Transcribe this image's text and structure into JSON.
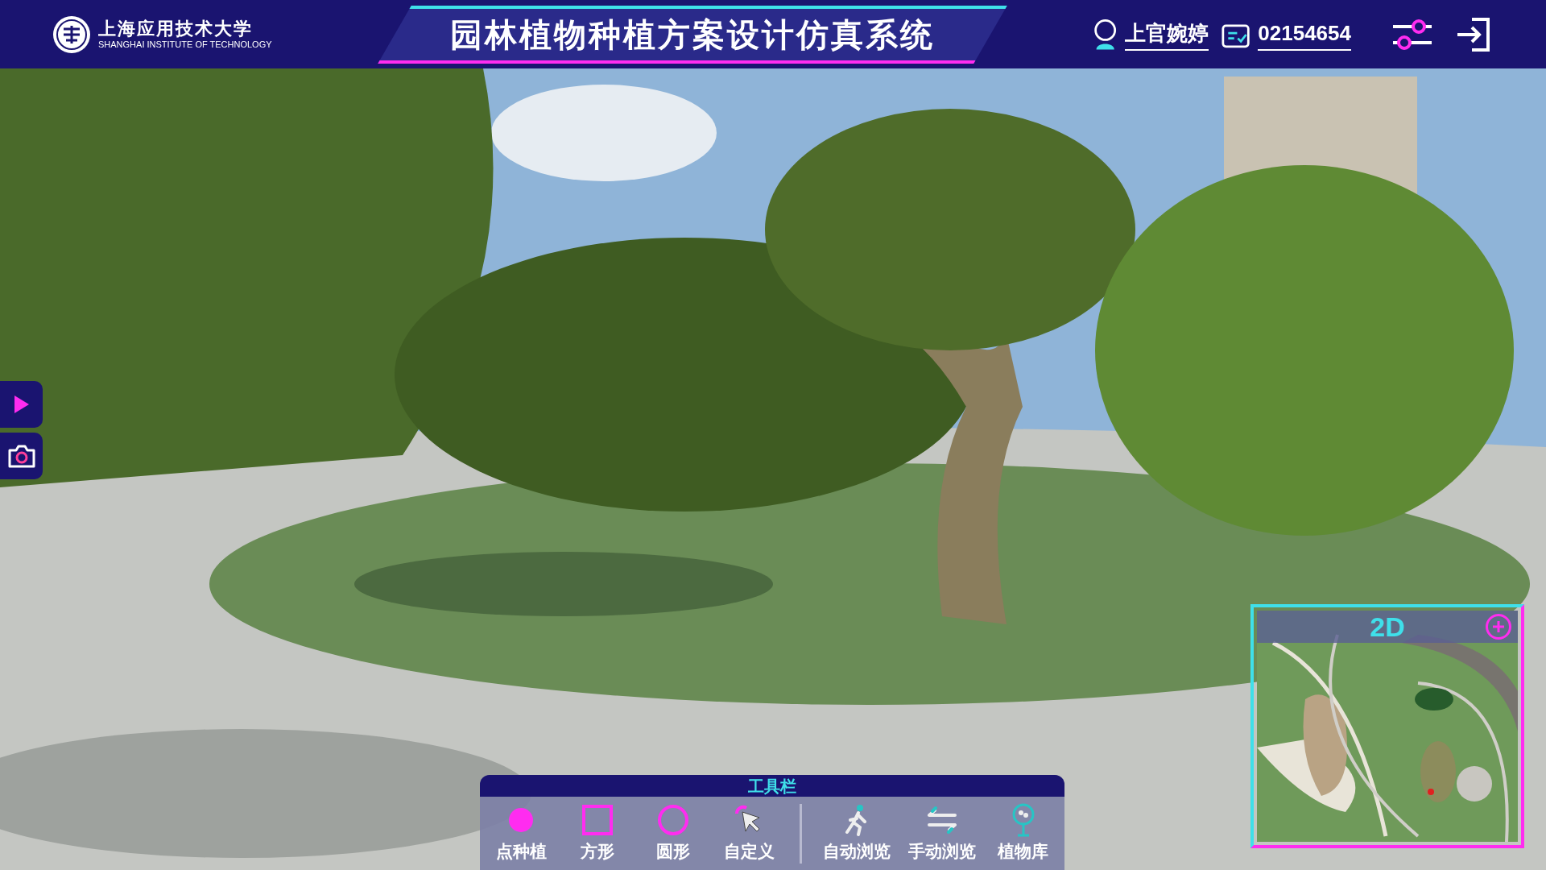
{
  "header": {
    "logo_name": "上海应用技术大学",
    "logo_subtitle": "SHANGHAI INSTITUTE OF TECHNOLOGY",
    "title": "园林植物种植方案设计仿真系统",
    "user_name": "上官婉婷",
    "user_id": "02154654"
  },
  "side_buttons": [
    {
      "kind": "play"
    },
    {
      "kind": "camera"
    }
  ],
  "toolbar": {
    "title": "工具栏",
    "tool_groups": [
      [
        {
          "label": "点种植",
          "kind": "dot"
        },
        {
          "label": "方形",
          "kind": "square"
        },
        {
          "label": "圆形",
          "kind": "circle"
        },
        {
          "label": "自定义",
          "kind": "custom"
        }
      ],
      [
        {
          "label": "自动浏览",
          "kind": "walk"
        },
        {
          "label": "手动浏览",
          "kind": "swap"
        },
        {
          "label": "植物库",
          "kind": "tree"
        }
      ]
    ]
  },
  "minimap": {
    "label": "2D"
  }
}
